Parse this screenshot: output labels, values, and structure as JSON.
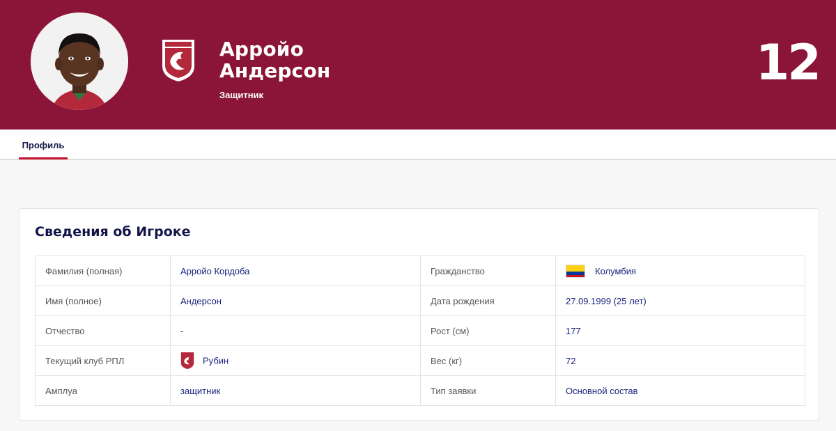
{
  "player": {
    "first_line": "Арройо",
    "second_line": "Андерсон",
    "position": "Защитник",
    "number": "12",
    "photo_icon": "player-photo"
  },
  "club_logo_icon": "rubin-logo",
  "colors": {
    "header_bg": "#8b1538",
    "accent": "#c8102e",
    "text_dark": "#1a237e"
  },
  "tabs": [
    {
      "label": "Профиль",
      "active": true
    }
  ],
  "info": {
    "title": "Сведения об Игроке",
    "rows": [
      {
        "label": "Фамилия (полная)",
        "value": "Арройо Кордоба",
        "label2": "Гражданство",
        "value2": "Колумбия"
      },
      {
        "label": "Имя (полное)",
        "value": "Андерсон",
        "label2": "Дата рождения",
        "value2": "27.09.1999 (25 лет)"
      },
      {
        "label": "Отчество",
        "value": "-",
        "label2": "Рост (см)",
        "value2": "177"
      },
      {
        "label": "Текущий клуб РПЛ",
        "value": "Рубин",
        "label2": "Вес (кг)",
        "value2": "72"
      },
      {
        "label": "Амплуа",
        "value": "защитник",
        "label2": "Тип заявки",
        "value2": "Основной состав"
      }
    ],
    "flag_icon": "colombia-flag-icon",
    "club_icon": "rubin-logo-icon"
  }
}
